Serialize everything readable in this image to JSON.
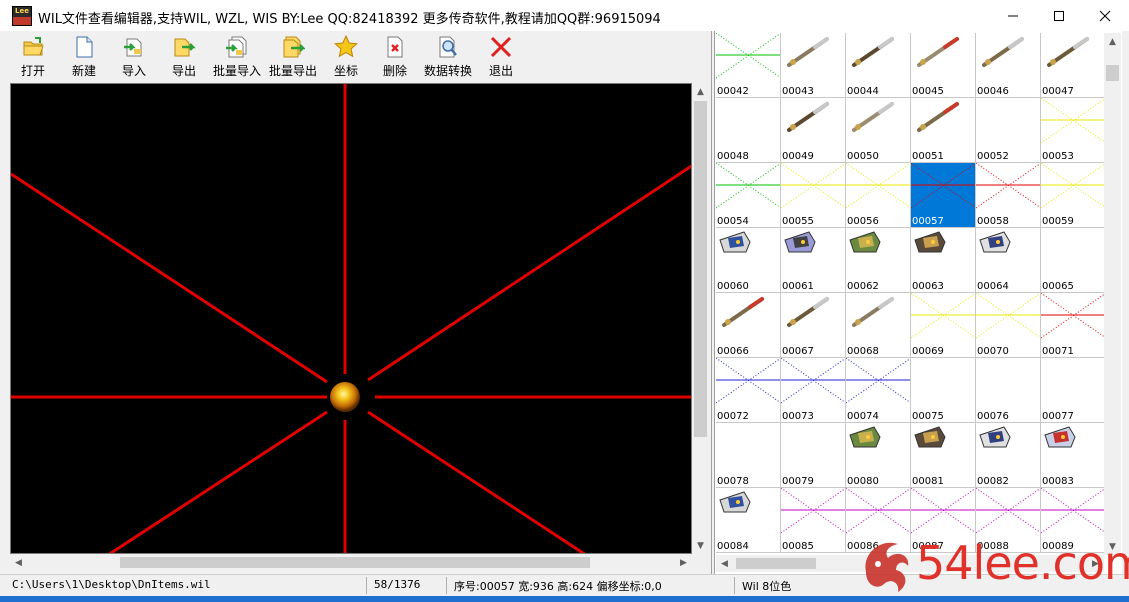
{
  "window": {
    "title": "WIL文件查看编辑器,支持WIL, WZL, WIS   BY:Lee   QQ:82418392   更多传奇软件,教程请加QQ群:96915094",
    "icon_top_text": "Lee"
  },
  "toolbar": {
    "items": [
      {
        "label": "打开",
        "icon": "open-folder-icon"
      },
      {
        "label": "新建",
        "icon": "new-file-icon"
      },
      {
        "label": "导入",
        "icon": "import-icon"
      },
      {
        "label": "导出",
        "icon": "export-icon"
      },
      {
        "label": "批量导入",
        "icon": "batch-import-icon"
      },
      {
        "label": "批量导出",
        "icon": "batch-export-icon"
      },
      {
        "label": "坐标",
        "icon": "star-icon"
      },
      {
        "label": "删除",
        "icon": "delete-icon"
      },
      {
        "label": "数据转换",
        "icon": "convert-icon"
      },
      {
        "label": "退出",
        "icon": "exit-icon"
      }
    ]
  },
  "grid": {
    "selected": "00057",
    "cells": [
      {
        "id": "00042",
        "kind": "dotted",
        "color": "#00c000"
      },
      {
        "id": "00043",
        "kind": "weapon"
      },
      {
        "id": "00044",
        "kind": "weapon"
      },
      {
        "id": "00045",
        "kind": "weapon"
      },
      {
        "id": "00046",
        "kind": "weapon"
      },
      {
        "id": "00047",
        "kind": "weapon"
      },
      {
        "id": "00048",
        "kind": "empty"
      },
      {
        "id": "00049",
        "kind": "weapon"
      },
      {
        "id": "00050",
        "kind": "weapon"
      },
      {
        "id": "00051",
        "kind": "weapon"
      },
      {
        "id": "00052",
        "kind": "empty"
      },
      {
        "id": "00053",
        "kind": "dotted",
        "color": "#e8e800"
      },
      {
        "id": "00054",
        "kind": "dotted",
        "color": "#00c000"
      },
      {
        "id": "00055",
        "kind": "dotted",
        "color": "#e8e800"
      },
      {
        "id": "00056",
        "kind": "dotted",
        "color": "#e8e800"
      },
      {
        "id": "00057",
        "kind": "dotted",
        "color": "#e00000"
      },
      {
        "id": "00058",
        "kind": "dotted",
        "color": "#e00000"
      },
      {
        "id": "00059",
        "kind": "dotted",
        "color": "#e8e800"
      },
      {
        "id": "00060",
        "kind": "armor"
      },
      {
        "id": "00061",
        "kind": "armor"
      },
      {
        "id": "00062",
        "kind": "armor"
      },
      {
        "id": "00063",
        "kind": "armor"
      },
      {
        "id": "00064",
        "kind": "armor"
      },
      {
        "id": "00065",
        "kind": "empty"
      },
      {
        "id": "00066",
        "kind": "weapon"
      },
      {
        "id": "00067",
        "kind": "weapon"
      },
      {
        "id": "00068",
        "kind": "weapon"
      },
      {
        "id": "00069",
        "kind": "dotted",
        "color": "#e8e800"
      },
      {
        "id": "00070",
        "kind": "dotted",
        "color": "#e8e800"
      },
      {
        "id": "00071",
        "kind": "dotted",
        "color": "#e00000"
      },
      {
        "id": "00072",
        "kind": "dotted",
        "color": "#2020d0"
      },
      {
        "id": "00073",
        "kind": "dotted",
        "color": "#2020d0"
      },
      {
        "id": "00074",
        "kind": "dotted",
        "color": "#2020d0"
      },
      {
        "id": "00075",
        "kind": "empty"
      },
      {
        "id": "00076",
        "kind": "empty"
      },
      {
        "id": "00077",
        "kind": "empty"
      },
      {
        "id": "00078",
        "kind": "empty"
      },
      {
        "id": "00079",
        "kind": "empty"
      },
      {
        "id": "00080",
        "kind": "armor"
      },
      {
        "id": "00081",
        "kind": "armor"
      },
      {
        "id": "00082",
        "kind": "armor"
      },
      {
        "id": "00083",
        "kind": "armor"
      },
      {
        "id": "00084",
        "kind": "armor"
      },
      {
        "id": "00085",
        "kind": "dotted",
        "color": "#c000c0"
      },
      {
        "id": "00086",
        "kind": "dotted",
        "color": "#c000c0"
      },
      {
        "id": "00087",
        "kind": "dotted",
        "color": "#c000c0"
      },
      {
        "id": "00088",
        "kind": "dotted",
        "color": "#c000c0"
      },
      {
        "id": "00089",
        "kind": "dotted",
        "color": "#c000c0"
      }
    ]
  },
  "status": {
    "path": "C:\\Users\\1\\Desktop\\DnItems.wil",
    "count": "58/1376",
    "info": "序号:00057 宽:936 高:624 偏移坐标:0,0",
    "format": "Wil 8位色"
  },
  "watermark": {
    "text": "54lee.com"
  },
  "colors": {
    "selection": "#0078d7",
    "crosshair": "#e00000",
    "viewer_bg": "#000000"
  }
}
